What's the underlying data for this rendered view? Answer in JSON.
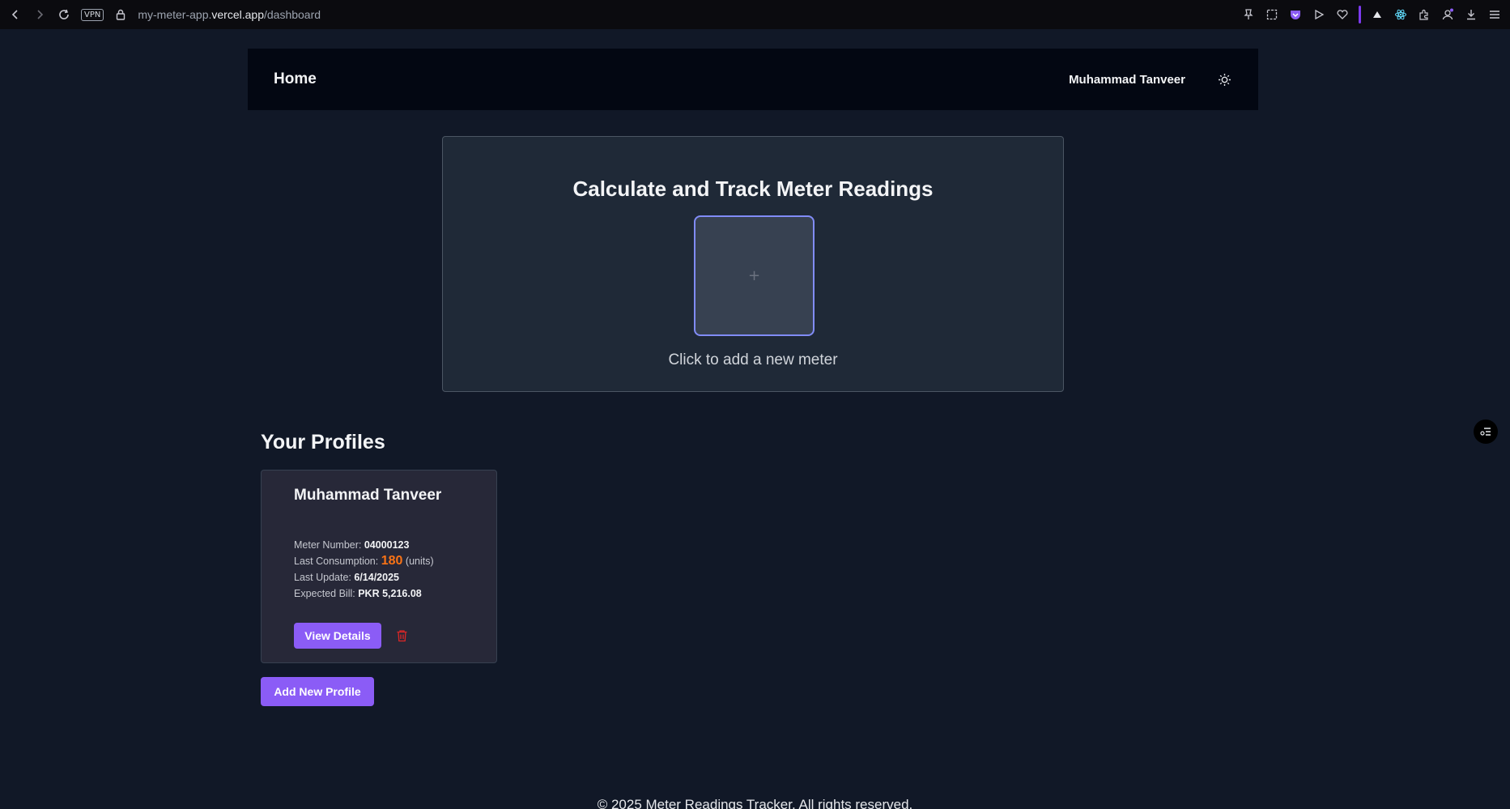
{
  "browser": {
    "vpn_label": "VPN",
    "url_prefix": "my-meter-app.",
    "url_domain": "vercel.app",
    "url_path": "/dashboard"
  },
  "navbar": {
    "home_label": "Home",
    "user_name": "Muhammad Tanveer"
  },
  "hero": {
    "title": "Calculate and Track Meter Readings",
    "plus": "+",
    "caption": "Click to add a new meter"
  },
  "profiles": {
    "title": "Your Profiles",
    "cards": [
      {
        "name": "Muhammad Tanveer",
        "meter_label": "Meter Number:",
        "meter_value": "04000123",
        "consumption_label": "Last Consumption:",
        "consumption_value": "180",
        "consumption_unit": "(units)",
        "update_label": "Last Update:",
        "update_value": "6/14/2025",
        "bill_label": "Expected Bill:",
        "bill_value": "PKR 5,216.08",
        "view_label": "View Details"
      }
    ],
    "add_label": "Add New Profile"
  },
  "footer": {
    "text": "© 2025 Meter Readings Tracker. All rights reserved."
  },
  "colors": {
    "accent": "#8b5cf6",
    "consumption": "#f97316",
    "delete": "#dc2626"
  }
}
